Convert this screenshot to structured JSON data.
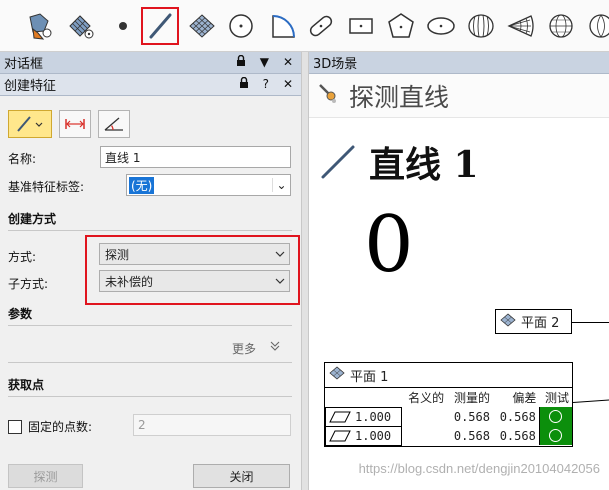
{
  "toolbar": {
    "tools": [
      {
        "icon": "auto-feature-icon"
      },
      {
        "icon": "point-cloud-icon"
      },
      {
        "icon": "point-icon"
      },
      {
        "icon": "line-icon",
        "selected": true
      },
      {
        "icon": "plane-icon"
      },
      {
        "icon": "circle-icon"
      },
      {
        "icon": "arc-icon"
      },
      {
        "icon": "slot-icon"
      },
      {
        "icon": "rectangle-icon"
      },
      {
        "icon": "polygon-icon"
      },
      {
        "icon": "ellipse-icon"
      },
      {
        "icon": "cylinder-icon"
      },
      {
        "icon": "cone-icon"
      },
      {
        "icon": "sphere-icon"
      },
      {
        "icon": "more-icon"
      }
    ]
  },
  "dialog_panel": {
    "title": "对话框"
  },
  "create_panel": {
    "title": "创建特征",
    "name_label": "名称:",
    "name_value": "直线 1",
    "datum_label": "基准特征标签:",
    "datum_value": "(无)",
    "method_section": "创建方式",
    "method_label": "方式:",
    "method_value": "探测",
    "submethod_label": "子方式:",
    "submethod_value": "未补偿的",
    "params_section": "参数",
    "more_label": "更多",
    "capture_section": "获取点",
    "fixed_points_label": "固定的点数:",
    "fixed_points_value": "2",
    "probe_button": "探测",
    "close_button": "关闭"
  },
  "scene": {
    "tab": "3D场景",
    "header": "探测直线",
    "feature_title": "直线 1",
    "big_number": "0",
    "plane2_label": "平面 2",
    "plane1_label": "平面 1",
    "table": {
      "headers": [
        "名义的",
        "测量的",
        "偏差",
        "测试"
      ],
      "rows": [
        {
          "factor": "1.000",
          "nominal": "",
          "measured": "0.568",
          "deviation": "0.568"
        },
        {
          "factor": "1.000",
          "nominal": "",
          "measured": "0.568",
          "deviation": "0.568"
        }
      ]
    },
    "watermark": "https://blog.csdn.net/dengjin20104042056"
  },
  "colors": {
    "accent_red": "#e0141e",
    "pass_green": "#0c8f0c",
    "titlebar": "#c9d3e1"
  }
}
